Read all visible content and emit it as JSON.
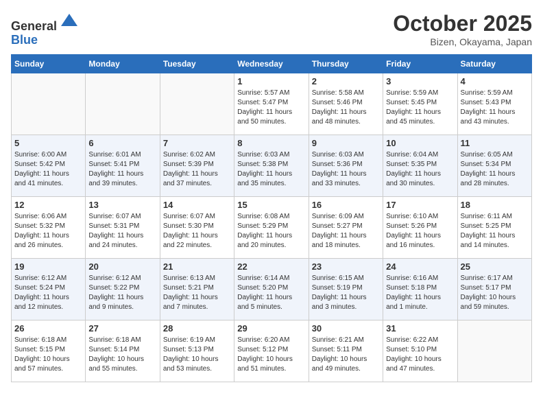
{
  "header": {
    "logo_line1": "General",
    "logo_line2": "Blue",
    "month": "October 2025",
    "location": "Bizen, Okayama, Japan"
  },
  "weekdays": [
    "Sunday",
    "Monday",
    "Tuesday",
    "Wednesday",
    "Thursday",
    "Friday",
    "Saturday"
  ],
  "weeks": [
    [
      {
        "day": "",
        "info": ""
      },
      {
        "day": "",
        "info": ""
      },
      {
        "day": "",
        "info": ""
      },
      {
        "day": "1",
        "info": "Sunrise: 5:57 AM\nSunset: 5:47 PM\nDaylight: 11 hours\nand 50 minutes."
      },
      {
        "day": "2",
        "info": "Sunrise: 5:58 AM\nSunset: 5:46 PM\nDaylight: 11 hours\nand 48 minutes."
      },
      {
        "day": "3",
        "info": "Sunrise: 5:59 AM\nSunset: 5:45 PM\nDaylight: 11 hours\nand 45 minutes."
      },
      {
        "day": "4",
        "info": "Sunrise: 5:59 AM\nSunset: 5:43 PM\nDaylight: 11 hours\nand 43 minutes."
      }
    ],
    [
      {
        "day": "5",
        "info": "Sunrise: 6:00 AM\nSunset: 5:42 PM\nDaylight: 11 hours\nand 41 minutes."
      },
      {
        "day": "6",
        "info": "Sunrise: 6:01 AM\nSunset: 5:41 PM\nDaylight: 11 hours\nand 39 minutes."
      },
      {
        "day": "7",
        "info": "Sunrise: 6:02 AM\nSunset: 5:39 PM\nDaylight: 11 hours\nand 37 minutes."
      },
      {
        "day": "8",
        "info": "Sunrise: 6:03 AM\nSunset: 5:38 PM\nDaylight: 11 hours\nand 35 minutes."
      },
      {
        "day": "9",
        "info": "Sunrise: 6:03 AM\nSunset: 5:36 PM\nDaylight: 11 hours\nand 33 minutes."
      },
      {
        "day": "10",
        "info": "Sunrise: 6:04 AM\nSunset: 5:35 PM\nDaylight: 11 hours\nand 30 minutes."
      },
      {
        "day": "11",
        "info": "Sunrise: 6:05 AM\nSunset: 5:34 PM\nDaylight: 11 hours\nand 28 minutes."
      }
    ],
    [
      {
        "day": "12",
        "info": "Sunrise: 6:06 AM\nSunset: 5:32 PM\nDaylight: 11 hours\nand 26 minutes."
      },
      {
        "day": "13",
        "info": "Sunrise: 6:07 AM\nSunset: 5:31 PM\nDaylight: 11 hours\nand 24 minutes."
      },
      {
        "day": "14",
        "info": "Sunrise: 6:07 AM\nSunset: 5:30 PM\nDaylight: 11 hours\nand 22 minutes."
      },
      {
        "day": "15",
        "info": "Sunrise: 6:08 AM\nSunset: 5:29 PM\nDaylight: 11 hours\nand 20 minutes."
      },
      {
        "day": "16",
        "info": "Sunrise: 6:09 AM\nSunset: 5:27 PM\nDaylight: 11 hours\nand 18 minutes."
      },
      {
        "day": "17",
        "info": "Sunrise: 6:10 AM\nSunset: 5:26 PM\nDaylight: 11 hours\nand 16 minutes."
      },
      {
        "day": "18",
        "info": "Sunrise: 6:11 AM\nSunset: 5:25 PM\nDaylight: 11 hours\nand 14 minutes."
      }
    ],
    [
      {
        "day": "19",
        "info": "Sunrise: 6:12 AM\nSunset: 5:24 PM\nDaylight: 11 hours\nand 12 minutes."
      },
      {
        "day": "20",
        "info": "Sunrise: 6:12 AM\nSunset: 5:22 PM\nDaylight: 11 hours\nand 9 minutes."
      },
      {
        "day": "21",
        "info": "Sunrise: 6:13 AM\nSunset: 5:21 PM\nDaylight: 11 hours\nand 7 minutes."
      },
      {
        "day": "22",
        "info": "Sunrise: 6:14 AM\nSunset: 5:20 PM\nDaylight: 11 hours\nand 5 minutes."
      },
      {
        "day": "23",
        "info": "Sunrise: 6:15 AM\nSunset: 5:19 PM\nDaylight: 11 hours\nand 3 minutes."
      },
      {
        "day": "24",
        "info": "Sunrise: 6:16 AM\nSunset: 5:18 PM\nDaylight: 11 hours\nand 1 minute."
      },
      {
        "day": "25",
        "info": "Sunrise: 6:17 AM\nSunset: 5:17 PM\nDaylight: 10 hours\nand 59 minutes."
      }
    ],
    [
      {
        "day": "26",
        "info": "Sunrise: 6:18 AM\nSunset: 5:15 PM\nDaylight: 10 hours\nand 57 minutes."
      },
      {
        "day": "27",
        "info": "Sunrise: 6:18 AM\nSunset: 5:14 PM\nDaylight: 10 hours\nand 55 minutes."
      },
      {
        "day": "28",
        "info": "Sunrise: 6:19 AM\nSunset: 5:13 PM\nDaylight: 10 hours\nand 53 minutes."
      },
      {
        "day": "29",
        "info": "Sunrise: 6:20 AM\nSunset: 5:12 PM\nDaylight: 10 hours\nand 51 minutes."
      },
      {
        "day": "30",
        "info": "Sunrise: 6:21 AM\nSunset: 5:11 PM\nDaylight: 10 hours\nand 49 minutes."
      },
      {
        "day": "31",
        "info": "Sunrise: 6:22 AM\nSunset: 5:10 PM\nDaylight: 10 hours\nand 47 minutes."
      },
      {
        "day": "",
        "info": ""
      }
    ]
  ]
}
